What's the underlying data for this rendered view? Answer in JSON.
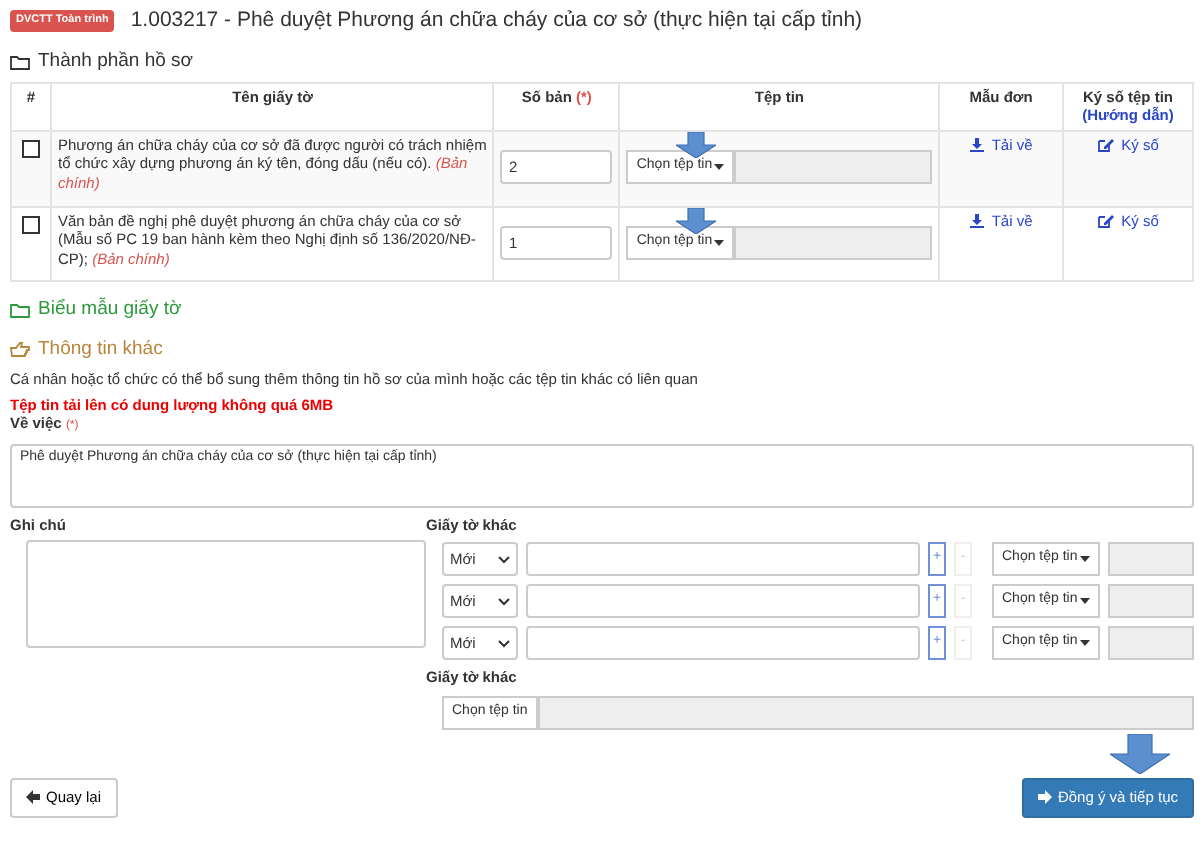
{
  "header": {
    "badge": "DVCTT Toàn trình",
    "title": "1.003217 - Phê duyệt Phương án chữa cháy của cơ sở (thực hiện tại cấp tỉnh)"
  },
  "documents": {
    "heading": "Thành phần hồ sơ",
    "columns": [
      {
        "label": "#"
      },
      {
        "label": "Tên giấy tờ"
      },
      {
        "label": "Số bản",
        "required": "(*)"
      },
      {
        "label": "Tệp tin"
      },
      {
        "label": "Mẫu đơn"
      },
      {
        "label": "Ký số tệp tin",
        "note": "(Hướng dẫn)"
      }
    ],
    "rows": [
      {
        "checked": false,
        "name": "Phương án chữa cháy của cơ sở đã được người có trách nhiệm tổ chức xây dựng phương án ký tên, đóng dấu (nếu có).",
        "tag": "(Bản chính)",
        "copies": "2",
        "file_button": "Chọn tệp tin",
        "download": "Tải về",
        "sign": "Ký số"
      },
      {
        "checked": false,
        "name": "Văn bản đề nghị phê duyệt phương án chữa cháy của cơ sở (Mẫu số PC 19 ban hành kèm theo Nghị định số 136/2020/NĐ-CP);",
        "tag": "(Bản chính)",
        "copies": "1",
        "file_button": "Chọn tệp tin",
        "download": "Tải về",
        "sign": "Ký số"
      }
    ]
  },
  "forms_link": "Biểu mẫu giấy tờ",
  "other_info": {
    "heading": "Thông tin khác",
    "description": "Cá nhân hoặc tổ chức có thể bổ sung thêm thông tin hồ sơ của mình hoặc các tệp tin khác có liên quan",
    "warning": "Tệp tin tải lên có dung lượng không quá 6MB",
    "subject_label": "Về việc",
    "subject_required": "(*)",
    "subject_value": "Phê duyệt Phương án chữa cháy của cơ sở (thực hiện tại cấp tỉnh)",
    "note_label": "Ghi chú",
    "other_docs_label": "Giấy tờ khác",
    "other_docs": [
      {
        "type": "Mới",
        "add": "+",
        "remove": "-",
        "file_button": "Chọn tệp tin"
      },
      {
        "type": "Mới",
        "add": "+",
        "remove": "-",
        "file_button": "Chọn tệp tin"
      },
      {
        "type": "Mới",
        "add": "+",
        "remove": "-",
        "file_button": "Chọn tệp tin"
      }
    ],
    "other_file_label": "Giấy tờ khác",
    "other_file_button": "Chọn tệp tin"
  },
  "buttons": {
    "back": "Quay lại",
    "next": "Đồng ý và tiếp tục"
  }
}
